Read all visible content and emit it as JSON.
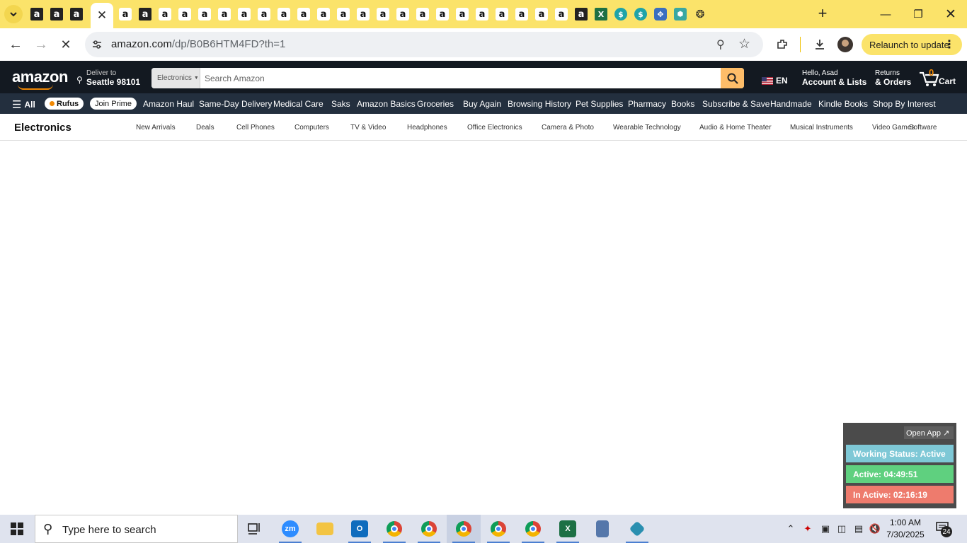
{
  "browser": {
    "tab_favicons": [
      "amazon",
      "amazon",
      "amazon",
      "amazon-active",
      "amazon-light",
      "amazon",
      "amazon-light",
      "amazon-light",
      "amazon-light",
      "amazon-light",
      "amazon-light",
      "amazon-light",
      "amazon-light",
      "amazon-light",
      "amazon-light",
      "amazon-light",
      "amazon-light",
      "amazon-light",
      "amazon-light",
      "amazon-light",
      "amazon-light",
      "amazon-light",
      "amazon-light",
      "amazon-light",
      "amazon-light",
      "amazon-light",
      "amazon-light",
      "amazon",
      "excel",
      "dollar",
      "dollar",
      "gear",
      "hex",
      "openai"
    ],
    "url_host": "amazon.com",
    "url_path": "/dp/B0B6HTM4FD?th=1",
    "relaunch_label": "Relaunch to update",
    "new_tab_glyph": "+",
    "active_tab_close_glyph": "✕"
  },
  "amazon": {
    "logo_text": "amazon",
    "deliver_line1": "Deliver to",
    "deliver_line2": "Seattle 98101",
    "search_category": "Electronics",
    "search_placeholder": "Search Amazon",
    "language": "EN",
    "account_line1": "Hello, Asad",
    "account_line2": "Account & Lists",
    "returns_line1": "Returns",
    "returns_line2": "& Orders",
    "cart_count": "0",
    "cart_label": "Cart",
    "nav": {
      "all_label": "All",
      "rufus_label": "Rufus",
      "join_prime_label": "Join Prime",
      "links": [
        "Amazon Haul",
        "Same-Day Delivery",
        "Medical Care",
        "Saks",
        "Amazon Basics",
        "Groceries",
        "Buy Again",
        "Browsing History",
        "Pet Supplies",
        "Pharmacy",
        "Books",
        "Subscribe & Save",
        "Handmade",
        "Kindle Books",
        "Shop By Interest"
      ]
    },
    "subnav": {
      "title": "Electronics",
      "links": [
        "New Arrivals",
        "Deals",
        "Cell Phones",
        "Computers",
        "TV & Video",
        "Headphones",
        "Office Electronics",
        "Camera & Photo",
        "Wearable Technology",
        "Audio & Home Theater",
        "Musical Instruments",
        "Video Games",
        "Software"
      ]
    }
  },
  "widget": {
    "open_app_label": "Open App ↗",
    "working_status": "Working Status: Active",
    "active_time": "Active: 04:49:51",
    "inactive_time": "In Active: 02:16:19",
    "colors": {
      "status": "#7ec8d6",
      "active": "#5fd07f",
      "inactive": "#ee7b6d"
    }
  },
  "taskbar": {
    "search_placeholder": "Type here to search",
    "zoom_label": "zm",
    "excel_label": "X",
    "time": "1:00 AM",
    "date": "7/30/2025",
    "notification_count": "24"
  }
}
